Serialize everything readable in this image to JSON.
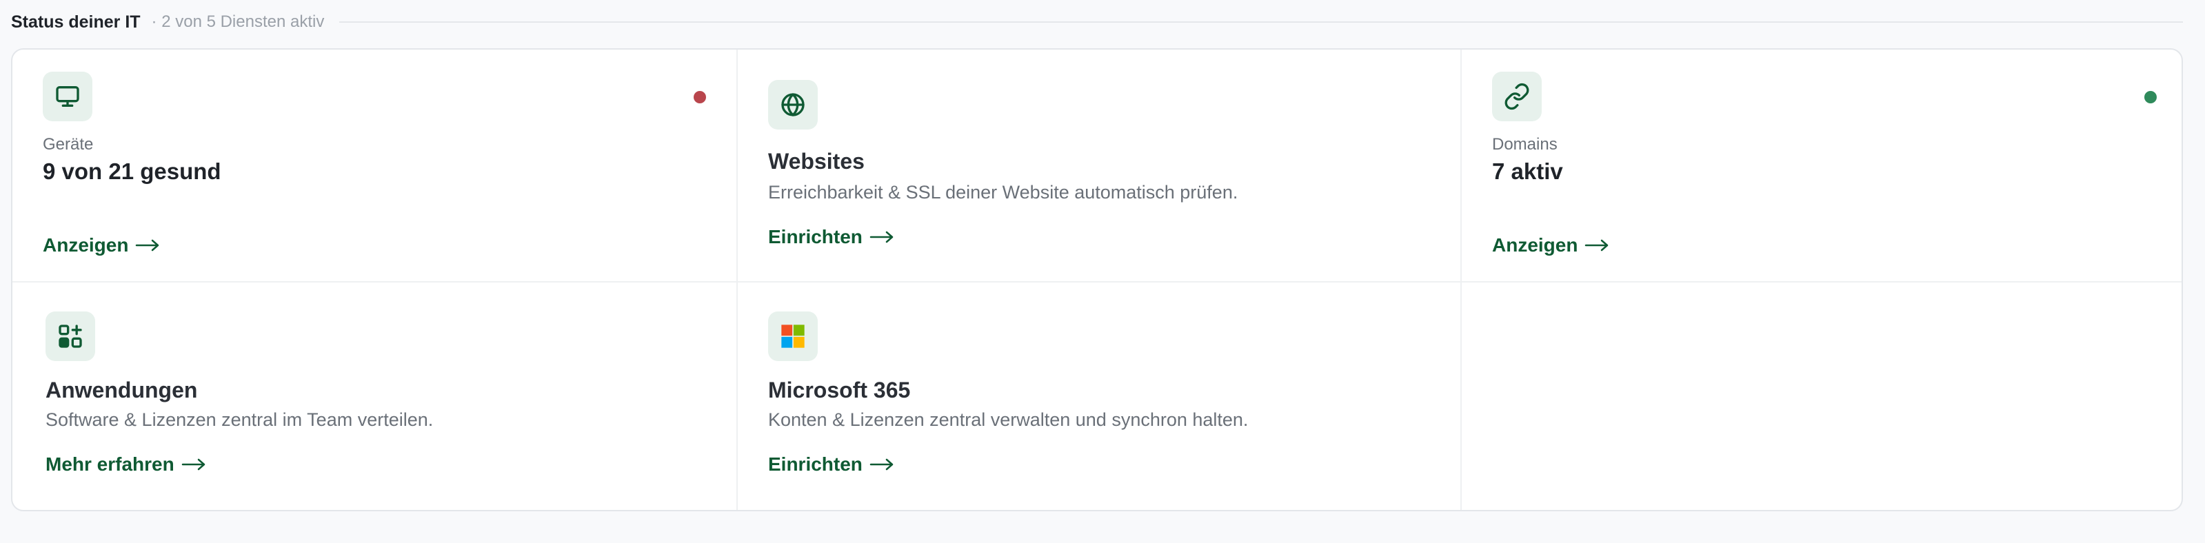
{
  "header": {
    "title": "Status deiner IT",
    "count_text": "· 2 von 5 Diensten aktiv"
  },
  "colors": {
    "accent": "#0f5a33",
    "icon_bg": "#e7f1ec",
    "status_error": "#b9454c",
    "status_ok": "#2f8a5b"
  },
  "cards": {
    "devices": {
      "icon": "monitor-icon",
      "label": "Geräte",
      "value": "9 von 21 gesund",
      "status": "error",
      "link": "Anzeigen"
    },
    "websites": {
      "icon": "globe-icon",
      "title": "Websites",
      "description": "Erreichbarkeit & SSL deiner Website automatisch prüfen.",
      "link": "Einrichten"
    },
    "domains": {
      "icon": "link-icon",
      "label": "Domains",
      "value": "7 aktiv",
      "status": "ok",
      "link": "Anzeigen"
    },
    "apps": {
      "icon": "apps-add-icon",
      "title": "Anwendungen",
      "description": "Software & Lizenzen zentral im Team verteilen.",
      "link": "Mehr erfahren"
    },
    "microsoft": {
      "icon": "microsoft-logo-icon",
      "title": "Microsoft 365",
      "description": "Konten & Lizenzen zentral verwalten und synchron halten.",
      "link": "Einrichten"
    }
  }
}
